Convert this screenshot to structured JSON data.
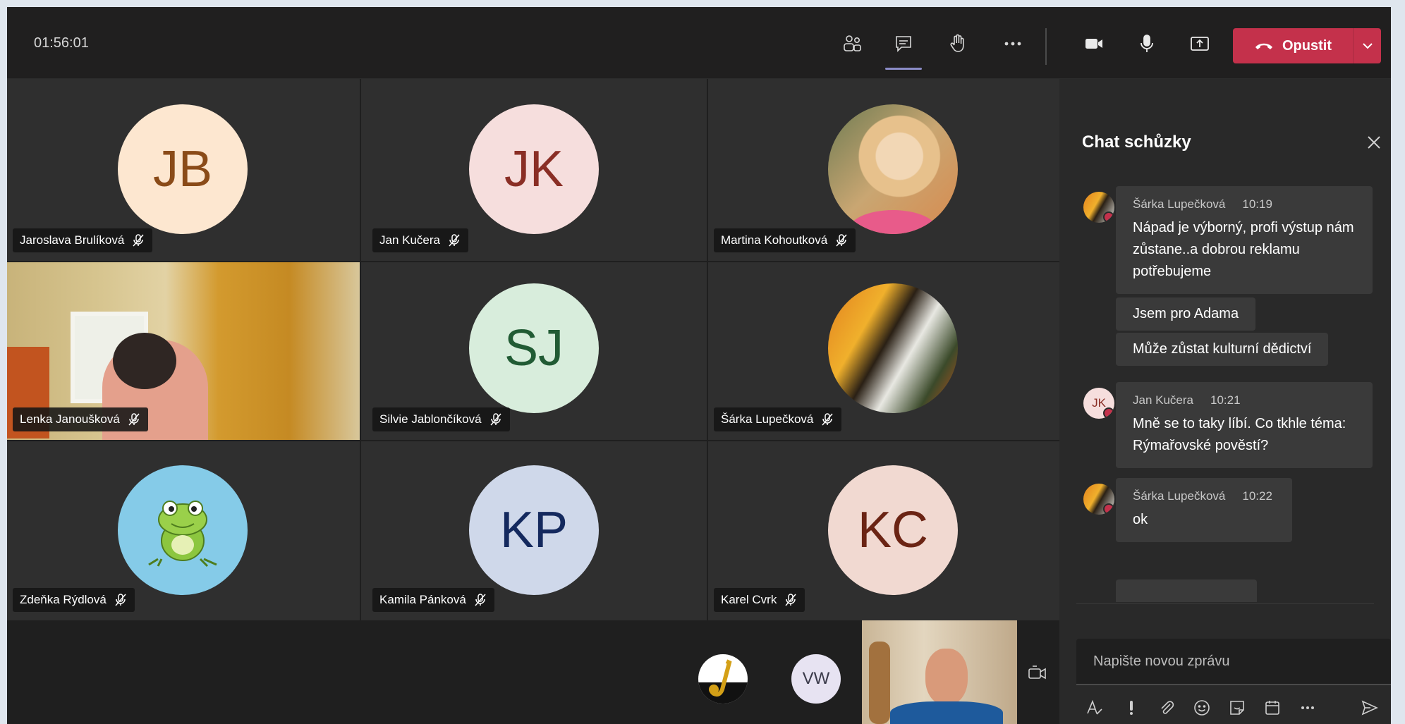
{
  "call": {
    "timer": "01:56:01",
    "leave_label": "Opustit"
  },
  "toolbar": {
    "icons": [
      "participants-icon",
      "chat-icon",
      "raise-hand-icon",
      "more-icon",
      "camera-icon",
      "microphone-icon",
      "share-screen-icon"
    ],
    "colors": {
      "leave": "#c4314b",
      "active_underline": "#8b8cc7"
    }
  },
  "participants": [
    {
      "name": "Jaroslava Brulíková",
      "initials": "JB",
      "avatar_bg": "#fde7d0",
      "initials_color": "#8a4b18"
    },
    {
      "name": "Jan Kučera",
      "initials": "JK",
      "avatar_bg": "#f6dedd",
      "initials_color": "#8a2e25"
    },
    {
      "name": "Martina Kohoutková",
      "initials": "",
      "avatar_bg": "#c9a672"
    },
    {
      "name": "Lenka Janoušková",
      "initials": ""
    },
    {
      "name": "Silvie Jablončíková",
      "initials": "SJ",
      "avatar_bg": "#d8eddc",
      "initials_color": "#215b34"
    },
    {
      "name": "Šárka Lupečková",
      "initials": "",
      "avatar_bg": "#d9791b"
    },
    {
      "name": "Zdeňka Rýdlová",
      "initials": "",
      "avatar_bg": "#85cbe8"
    },
    {
      "name": "Kamila Pánková",
      "initials": "KP",
      "avatar_bg": "#cfd8ea",
      "initials_color": "#14295e"
    },
    {
      "name": "Karel Cvrk",
      "initials": "KC",
      "avatar_bg": "#f1d9d1",
      "initials_color": "#6b2414"
    }
  ],
  "overflow": {
    "vw_initials": "VW"
  },
  "chat": {
    "title": "Chat schůzky",
    "messages": [
      {
        "author": "Šárka Lupečková",
        "time": "10:19",
        "text": "Nápad je výborný, profi výstup nám zůstane..a dobrou reklamu potřebujeme"
      },
      {
        "text": "Jsem pro Adama"
      },
      {
        "text": "Může zůstat kulturní dědictví"
      },
      {
        "author": "Jan Kučera",
        "initials": "JK",
        "time": "10:21",
        "text": "Mně se to taky líbí. Co tkhle téma: Rýmařovské pověstí?"
      },
      {
        "author": "Šárka Lupečková",
        "time": "10:22",
        "text": "ok"
      }
    ],
    "compose_placeholder": "Napište novou zprávu"
  }
}
